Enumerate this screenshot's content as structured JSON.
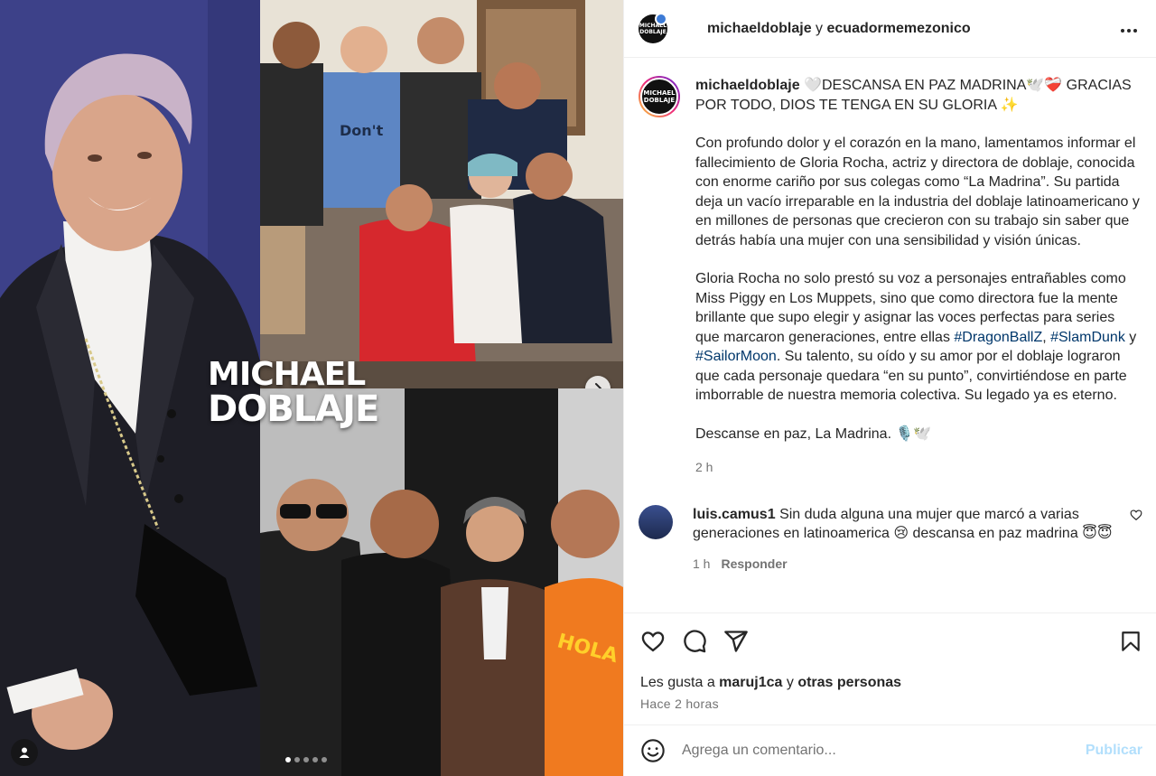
{
  "media": {
    "watermark_line1": "MICHAEL",
    "watermark_line2": "DOBLAJE",
    "shirt_text": "Don't touch me muggle",
    "orange_shirt_text": "HOLA SOY YO",
    "carousel_total": 5,
    "carousel_active": 1
  },
  "header": {
    "avatar_text": "MICHAEL DOBLAJE",
    "author": "michaeldoblaje",
    "connector": "y",
    "collaborator": "ecuadormemezonico",
    "more_icon": "more-horizontal-icon"
  },
  "caption": {
    "avatar_text": "MICHAEL DOBLAJE",
    "username": "michaeldoblaje",
    "headline": "🤍DESCANSA EN PAZ MADRINA🕊️❤️‍🩹 GRACIAS POR TODO, DIOS TE TENGA EN SU GLORIA ✨",
    "paragraph1": "Con profundo dolor y el corazón en la mano, lamentamos informar el fallecimiento de Gloria Rocha, actriz y directora de doblaje, conocida con enorme cariño por sus colegas como “La Madrina”. Su partida deja un vacío irreparable en la industria del doblaje latinoamericano y en millones de personas que crecieron con su trabajo sin saber que detrás había una mujer con una sensibilidad y visión únicas.",
    "paragraph2_start": "Gloria Rocha no solo prestó su voz a personajes entrañables como Miss Piggy en Los Muppets, sino que como directora fue la mente brillante que supo elegir y asignar las voces perfectas para series que marcaron generaciones, entre ellas ",
    "hashtag1": "#DragonBallZ",
    "sep1": ", ",
    "hashtag2": "#SlamDunk",
    "sep2": " y ",
    "hashtag3": "#SailorMoon",
    "paragraph2_end": ". Su talento, su oído y su amor por el doblaje lograron que cada personaje quedara “en su punto”, convirtiéndose en parte imborrable de nuestra memoria colectiva. Su legado ya es eterno.",
    "paragraph3": "Descanse en paz, La Madrina. 🎙️🕊️",
    "time": "2 h"
  },
  "comments": [
    {
      "username": "luis.camus1",
      "text": "Sin duda alguna una mujer que marcó a varias generaciones en latinoamerica 😢 descansa en paz madrina 😇😇",
      "time": "1 h",
      "reply_label": "Responder"
    }
  ],
  "likes": {
    "prefix": "Les gusta a ",
    "user": "maruj1ca",
    "middle": " y ",
    "others": "otras personas",
    "time_ago": "Hace 2 horas"
  },
  "add_comment": {
    "placeholder": "Agrega un comentario...",
    "post_label": "Publicar"
  },
  "colors": {
    "link": "#00376b",
    "post_disabled": "#b2dffc",
    "meta": "#737373"
  }
}
